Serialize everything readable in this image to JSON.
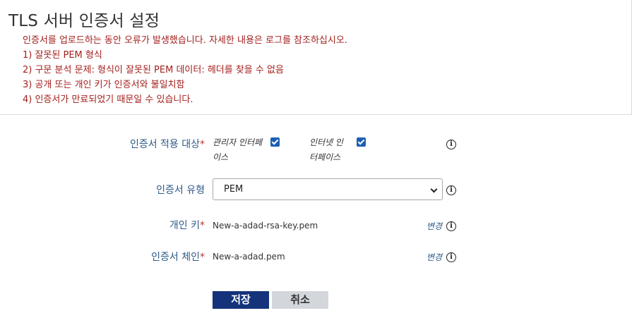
{
  "page": {
    "title": "TLS 서버 인증서 설정"
  },
  "errors": [
    "인증서를 업로드하는 동안 오류가 발생했습니다. 자세한 내용은 로그를 참조하십시오.",
    "1) 잘못된 PEM 형식",
    "2) 구문 분석 문제: 형식이 잘못된 PEM 데이터: 헤더를 찾을 수 없음",
    "3) 공개 또는 개인 키가 인증서와 불일치함",
    "4) 인증서가 만료되었기 때문일 수 있습니다."
  ],
  "form": {
    "apply_to": {
      "label": "인증서 적용 대상",
      "required_mark": "*",
      "options": [
        {
          "line1": "관리자 인터페",
          "line2": "이스",
          "checked": true
        },
        {
          "line1": "인터넷 인",
          "line2": "터페이스",
          "checked": true
        }
      ]
    },
    "type": {
      "label": "인증서 유형",
      "value": "PEM"
    },
    "private_key": {
      "label": "개인 키",
      "required_mark": "*",
      "value": "New-a-adad-rsa-key.pem",
      "change_label": "변경"
    },
    "chain": {
      "label": "인증서 체인",
      "required_mark": "*",
      "value": "New-a-adad.pem",
      "change_label": "변경"
    }
  },
  "buttons": {
    "save": "저장",
    "cancel": "취소"
  },
  "icons": {
    "info": "info-icon",
    "checkbox": "checkbox-checked",
    "dropdown": "chevron-down-icon"
  },
  "colors": {
    "error": "#a3201d",
    "label": "#2e5a88",
    "primary": "#14337a",
    "secondary": "#d3d6da",
    "checkbox": "#1a5fb4"
  }
}
